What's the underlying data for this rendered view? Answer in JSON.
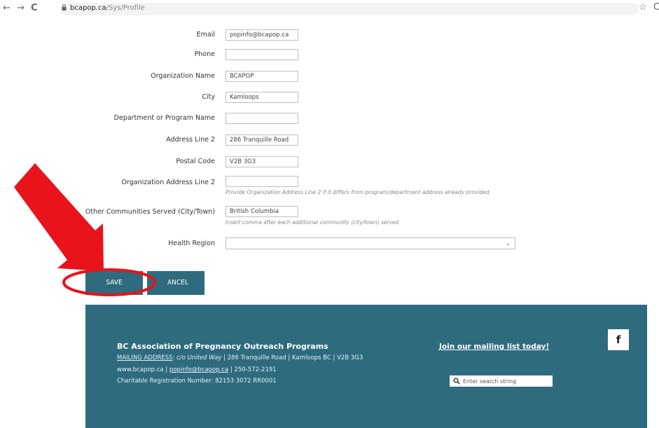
{
  "browser": {
    "back": "←",
    "forward": "→",
    "reload": "C",
    "url_host": "bcapop.ca",
    "url_path": "/Sys/Profile",
    "star": "☆",
    "more": "C"
  },
  "form": {
    "fields": [
      {
        "label": "Email",
        "value": "popinfo@bcapop.ca"
      },
      {
        "label": "Phone",
        "value": ""
      },
      {
        "label": "Organization Name",
        "value": "BCAPOP"
      },
      {
        "label": "City",
        "value": "Kamloops"
      },
      {
        "label": "Department or Program Name",
        "value": ""
      },
      {
        "label": "Address Line 2",
        "value": "286 Tranquille Road"
      },
      {
        "label": "Postal Code",
        "value": "V2B 3G3"
      },
      {
        "label": "Organization Address Line 2",
        "value": "",
        "help": "Provide Organization Address Line 2 if it differs from program/department address already provided."
      },
      {
        "label": "Other Communities Served (City/Town)",
        "value": "British Columbia",
        "help": "Insert comma after each additional community (city/town) served"
      },
      {
        "label": "Health Region",
        "value": ""
      }
    ],
    "select_arrow": "⌄"
  },
  "buttons": {
    "save": "SAVE",
    "cancel": "ANCEL"
  },
  "annotation": {
    "arrow_color": "#e8131b",
    "ellipse_color": "#e8131b"
  },
  "footer": {
    "org_name": "BC Association of Pregnancy Outreach Programs",
    "mailing_label": "MAILING ADDRESS",
    "mailing_colon": ":",
    "care_of": " c/o United Way",
    "address_rest": " | 286 Tranquille Road | Kamloops BC | V2B 3G3",
    "website": "www.bcapop.ca | ",
    "email": "popinfo@bcapop.ca",
    "phone": " | 250-572-2191",
    "charity": "Charitable Registration Number: 82153 3072 RR0001",
    "mailing_list": "Join our mailing list today!",
    "facebook": "f",
    "search_placeholder": "Enter search string",
    "bg_color": "#2e6b7f"
  }
}
